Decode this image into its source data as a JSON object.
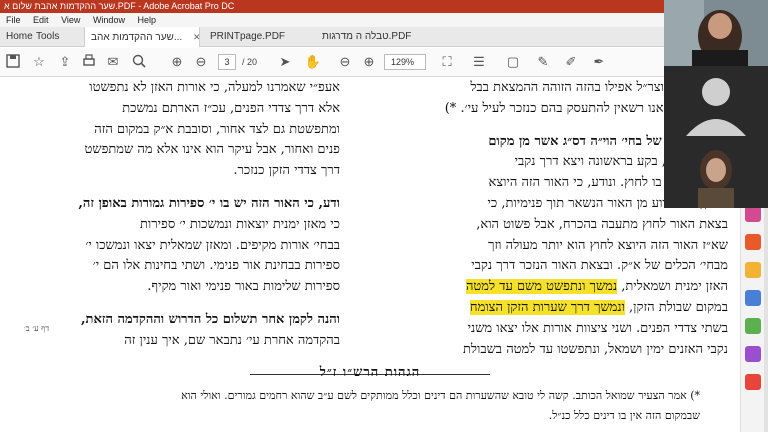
{
  "window": {
    "title": "שער ההקדמות אהבת שלום א.PDF - Adobe Acrobat Pro DC"
  },
  "menu": {
    "items": [
      "File",
      "Edit",
      "View",
      "Window",
      "Help"
    ]
  },
  "tabs": {
    "home": "Home",
    "tools": "Tools",
    "doc1": "שער ההקדמות אהב...",
    "doc2": "PRINTpage.PDF",
    "doc3": "טבלה ה מדרגות.PDF"
  },
  "toolbar": {
    "page_current": "3",
    "page_total": "/ 20",
    "zoom": "129%"
  },
  "document": {
    "right_column": [
      "בו אשר, והאוצר״ל אפילו בהזה הזוהה ההמצאת בבל",
      "השערות אין אנו רשאין להתעסק בהם כנזכר לעיל עי׳. *)",
      "ואמנם האור של בחי׳ הוי״ה דס״ג אשר מן מקום",
      "האזון ולמטה, בקע בראשונה ויצא דרך נקבי",
      "האזנים אשר בו לחוץ. ונודע, כי האור הזה היוצא",
      "לחוץ, הוא גרוע מן האור הנשאר תוך פנימיות, כי",
      "בצאת האור לחוץ מתעבה בהכרח, אבל פשוט הוא,",
      "שא״ז האור הזה היוצא לחוץ הוא יותר מעולה וזך",
      "מבחי׳ הכלים של א״ק. ובצאת האור הנזכר דרך נקבי",
      "האזן ימנית ושמאלית, נמשך ונתפשט משם עד למטה",
      "במקום שבולת הזקן, ונמשך דרך שערות הזקן הצומח",
      "בשתי צדדי הפנים. ושני ציצוות אורות אלו יצאו משני",
      "נקבי האזנים ימין ושמאל, ונתפשטו עד למטה בשבולת"
    ],
    "highlight_a": "נמשך ונתפשט משם עד למטה",
    "highlight_b": "ונמשך דרך שערות הזקן הצומח",
    "left_column": [
      "אעפ״י שאמרנו למעלה, כי אורות האזן לא נתפשטו",
      "אלא דרך צדדי הפנים, עכ״ז הארתם נמשכת",
      "ומתפשטת גם לצד אחור, וסובבת א״ק במקום הזה",
      "פנים ואחור, אבל עיקר הוא אינו אלא מה שמתפשט",
      "דרך צדדי הזקן כנזכר.",
      "ודע, כי האור הזה יש בו י׳ ספירות גמורות באופן זה,",
      "כי מאזן ימנית יוצאות ונמשכות י׳ ספירות",
      "בבחי׳ אורות מקיפים. ומאזן שמאלית יצאו ונמשכו י׳",
      "ספירות בבחינת אור פנימי. ושתי בחינות אלו הם י׳",
      "ספירות שלימות באור פנימי ואור מקיף.",
      "והנה לקמן אחר תשלום כל הדרוש וההקדמה הזאת,",
      "בהקדמה אחרת עי׳ נתבאר שם, איך ענין זה"
    ],
    "margin_note": "דף ע׳ ב׳",
    "notes_title": "הגהות הרש״ו ז״ל",
    "notes": [
      "*) אמר הצעיר שמואל הכותב. קשה לי טובא שהשערות הם דינים וכלל ממותקים לשם ע״ב שהוא רחמים גמורים. ואולי הוא",
      "שבמקום הזה אין בו דינים כלל כנ״ל."
    ]
  },
  "colors": {
    "titlebar": "#b9361f",
    "highlight": "#f5e12a"
  }
}
